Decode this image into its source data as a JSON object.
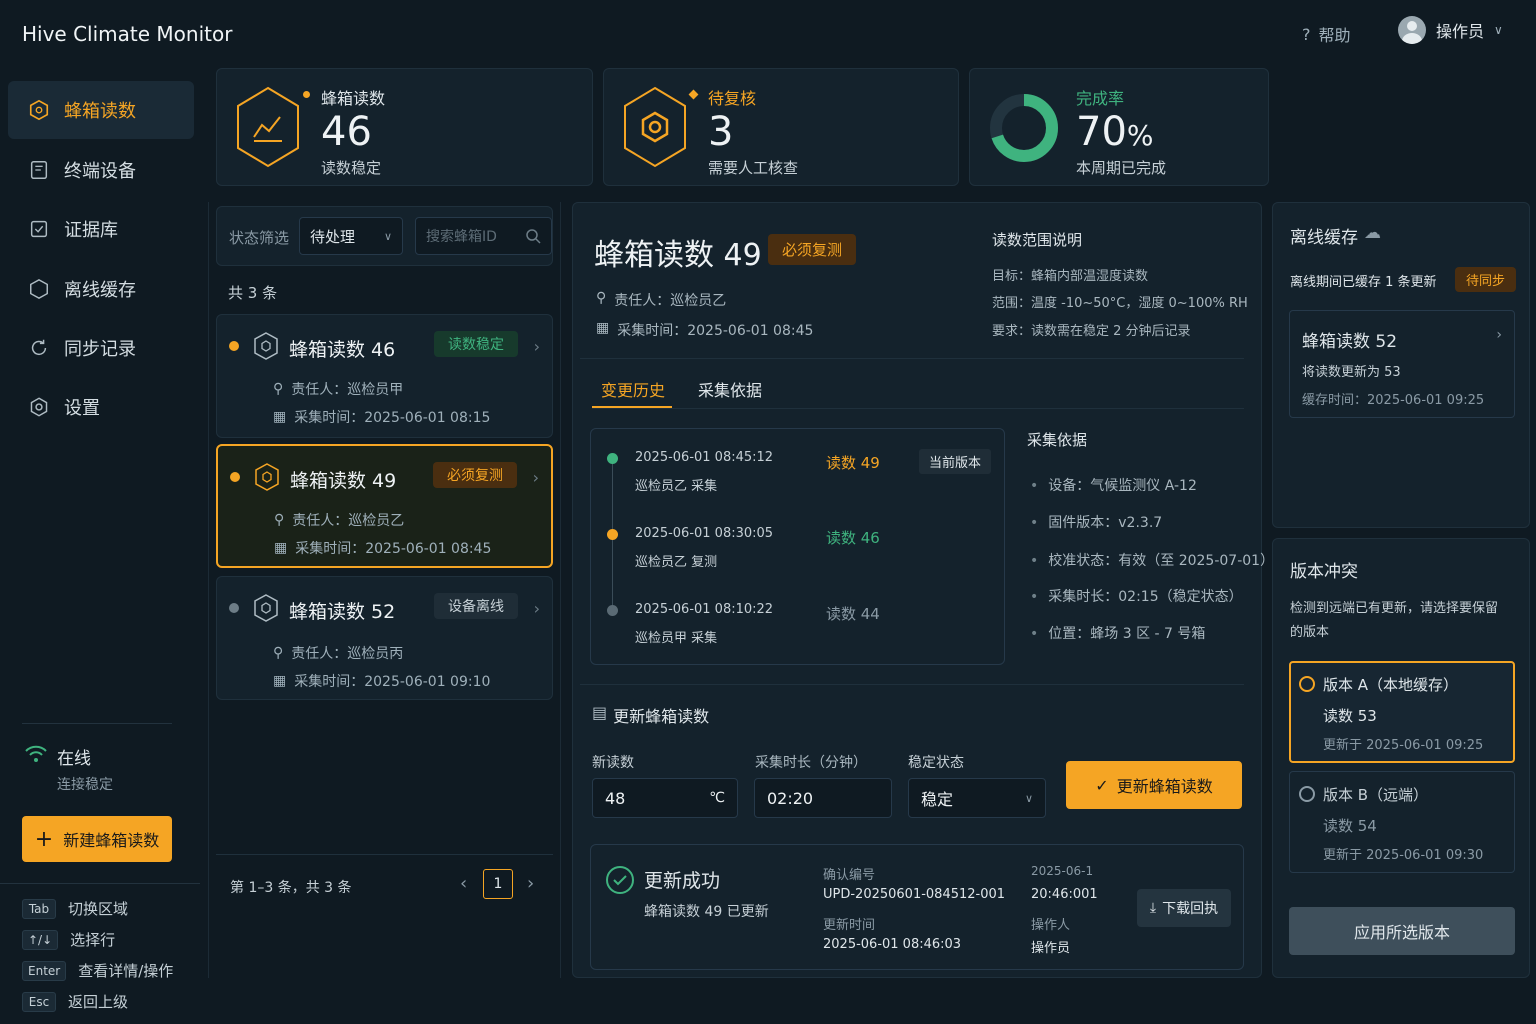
{
  "app": {
    "title": "Hive Climate Monitor",
    "help": "帮助",
    "user": "操作员"
  },
  "sidebar": {
    "items": [
      {
        "label": "蜂箱读数"
      },
      {
        "label": "终端设备"
      },
      {
        "label": "证据库"
      },
      {
        "label": "离线缓存"
      },
      {
        "label": "同步记录"
      },
      {
        "label": "设置"
      }
    ],
    "status": {
      "title": "在线",
      "sub": "连接稳定"
    },
    "new_button": "新建蜂箱读数",
    "shortcuts": [
      {
        "key": "Tab",
        "label": "切换区域"
      },
      {
        "key": "↑/↓",
        "label": "选择行"
      },
      {
        "key": "Enter",
        "label": "查看详情/操作"
      },
      {
        "key": "Esc",
        "label": "返回上级"
      }
    ]
  },
  "stats": [
    {
      "label": "蜂箱读数",
      "value": "46",
      "sub": "读数稳定"
    },
    {
      "label": "待复核",
      "value": "3",
      "sub": "需要人工核查"
    },
    {
      "label": "完成率",
      "value": "70",
      "unit": "%",
      "sub": "本周期已完成",
      "fraction": 0.7
    }
  ],
  "filter": {
    "label": "状态筛选",
    "value": "待处理",
    "search_placeholder": "搜索蜂箱ID",
    "count": "共 3 条"
  },
  "list": [
    {
      "name": "蜂箱读数 46",
      "badge": "读数稳定",
      "owner": "责任人：巡检员甲",
      "time": "采集时间：2025-06-01 08:15"
    },
    {
      "name": "蜂箱读数 49",
      "badge": "必须复测",
      "owner": "责任人：巡检员乙",
      "time": "采集时间：2025-06-01 08:45"
    },
    {
      "name": "蜂箱读数 52",
      "badge": "设备离线",
      "owner": "责任人：巡检员丙",
      "time": "采集时间：2025-06-01 09:10"
    }
  ],
  "pagination": {
    "summary": "第 1–3 条，共 3 条",
    "page": "1"
  },
  "detail": {
    "title": "蜂箱读数 49",
    "badge": "必须复测",
    "owner": "责任人：巡检员乙",
    "time": "采集时间：2025-06-01 08:45",
    "range": {
      "title": "读数范围说明",
      "lines": [
        "目标：蜂箱内部温湿度读数",
        "范围：温度 -10~50°C，湿度 0~100% RH",
        "要求：读数需在稳定 2 分钟后记录"
      ]
    },
    "tabs": [
      "变更历史",
      "采集依据"
    ],
    "history": [
      {
        "time": "2025-06-01 08:45:12",
        "who": "巡检员乙 采集",
        "reading": "读数 49",
        "tag": "当前版本"
      },
      {
        "time": "2025-06-01 08:30:05",
        "who": "巡检员乙 复测",
        "reading": "读数 46"
      },
      {
        "time": "2025-06-01 08:10:22",
        "who": "巡检员甲 采集",
        "reading": "读数 44"
      }
    ],
    "basis": {
      "title": "采集依据",
      "items": [
        "设备：气候监测仪 A-12",
        "固件版本：v2.3.7",
        "校准状态：有效（至 2025-07-01）",
        "采集时长：02:15（稳定状态）",
        "位置：蜂场 3 区 - 7 号箱"
      ]
    }
  },
  "update": {
    "title": "更新蜂箱读数",
    "new_label": "新读数",
    "new_value": "48",
    "unit": "℃",
    "duration_label": "采集时长（分钟）",
    "duration_value": "02:20",
    "state_label": "稳定状态",
    "state_value": "稳定",
    "submit": "更新蜂箱读数"
  },
  "success": {
    "title": "更新成功",
    "sub": "蜂箱读数 49 已更新",
    "confirm_label": "确认编号",
    "confirm_value": "UPD-20250601-084512-001",
    "overlay_a": "2025-06-1",
    "overlay_b": "20:46:001",
    "time_label": "更新时间",
    "time_value": "2025-06-01 08:46:03",
    "operator_label": "操作人",
    "operator_value": "操作员",
    "download": "下载回执"
  },
  "offline": {
    "title": "离线缓存",
    "sub": "离线期间已缓存 1 条更新",
    "badge": "待同步",
    "card_title": "蜂箱读数 52",
    "card_line": "将读数更新为 53",
    "card_time": "缓存时间：2025-06-01 09:25"
  },
  "conflict": {
    "title": "版本冲突",
    "desc": "检测到远端已有更新，请选择要保留的版本",
    "a": {
      "label": "版本 A（本地缓存）",
      "reading": "读数 53",
      "time": "更新于 2025-06-01 09:25"
    },
    "b": {
      "label": "版本 B（远端）",
      "reading": "读数 54",
      "time": "更新于 2025-06-01 09:30"
    },
    "apply": "应用所选版本"
  },
  "colors": {
    "accent": "#f5a524",
    "success": "#3fb37f",
    "bg": "#0f1a22",
    "panel": "#14222c"
  }
}
